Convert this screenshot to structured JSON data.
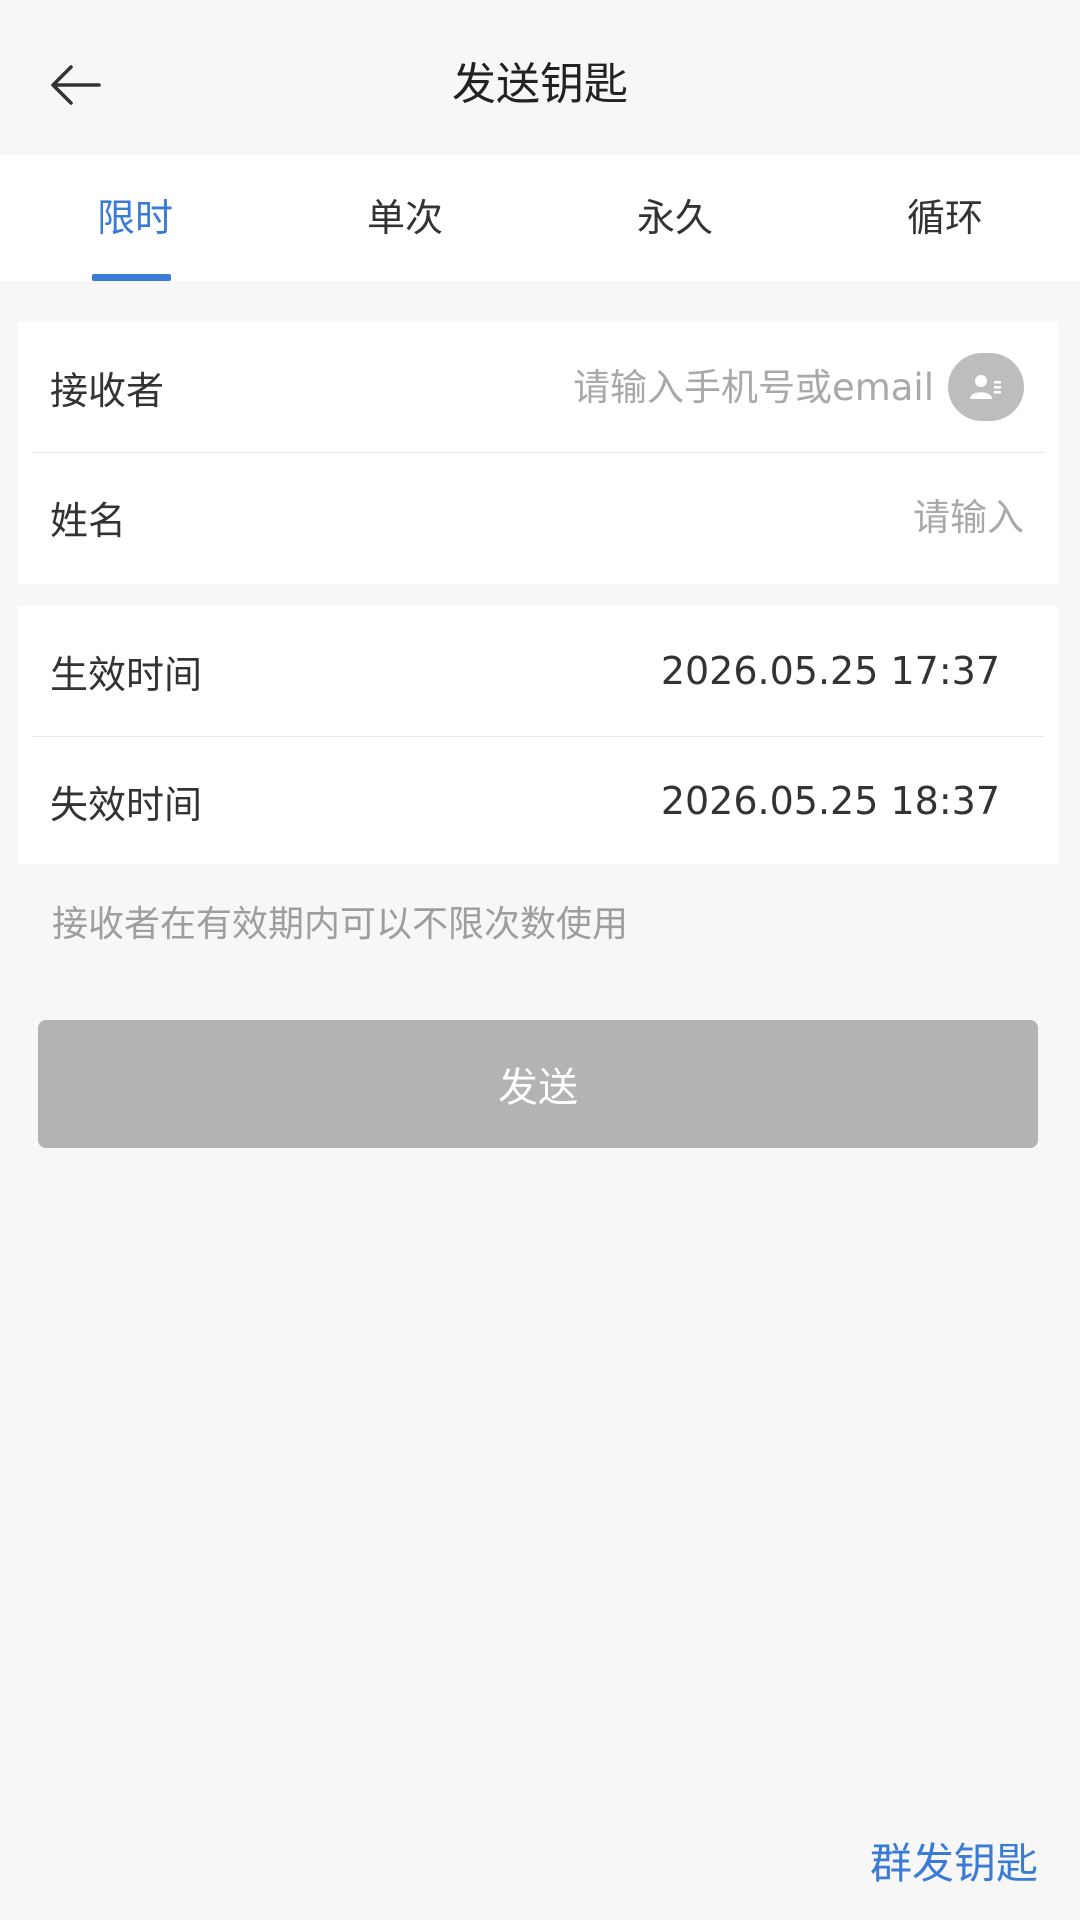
{
  "header": {
    "title": "发送钥匙",
    "back_icon": "arrow-left-icon"
  },
  "tabs": [
    {
      "label": "限时",
      "active": true
    },
    {
      "label": "单次",
      "active": false
    },
    {
      "label": "永久",
      "active": false
    },
    {
      "label": "循环",
      "active": false
    }
  ],
  "form": {
    "recipient": {
      "label": "接收者",
      "placeholder": "请输入手机号或email",
      "value": "",
      "contact_icon": "contact-card-icon"
    },
    "name": {
      "label": "姓名",
      "placeholder": "请输入",
      "value": ""
    },
    "start_time": {
      "label": "生效时间",
      "value": "2026.05.25 17:37"
    },
    "end_time": {
      "label": "失效时间",
      "value": "2026.05.25 18:37"
    }
  },
  "hint": "接收者在有效期内可以不限次数使用",
  "send_button": {
    "label": "发送",
    "enabled": false
  },
  "group_send_label": "群发钥匙",
  "colors": {
    "accent": "#3a7bd5",
    "background": "#f7f7f7",
    "disabled_button": "#b3b3b3"
  }
}
